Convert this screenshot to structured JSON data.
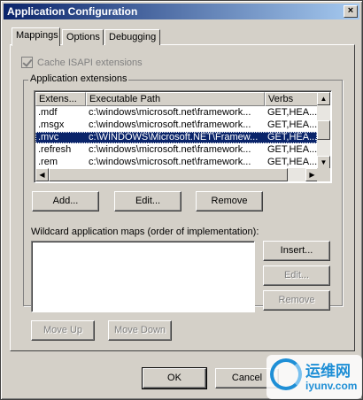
{
  "window": {
    "title": "Application Configuration",
    "close_label": "×"
  },
  "tabs": [
    {
      "label": "Mappings",
      "active": true
    },
    {
      "label": "Options",
      "active": false
    },
    {
      "label": "Debugging",
      "active": false
    }
  ],
  "mappings": {
    "cache_isapi": {
      "label": "Cache ISAPI extensions",
      "checked": true,
      "enabled": false
    },
    "group_title": "Application extensions",
    "list": {
      "columns": [
        "Extens...",
        "Executable Path",
        "Verbs"
      ],
      "rows": [
        {
          "ext": ".mdf",
          "path": "c:\\windows\\microsoft.net\\framework...",
          "verbs": "GET,HEA...",
          "selected": false
        },
        {
          "ext": ".msgx",
          "path": "c:\\windows\\microsoft.net\\framework...",
          "verbs": "GET,HEA...",
          "selected": false
        },
        {
          "ext": ".mvc",
          "path": "c:\\WINDOWS\\Microsoft.NET\\Framew...",
          "verbs": "GET,HEA...",
          "selected": true
        },
        {
          "ext": ".refresh",
          "path": "c:\\windows\\microsoft.net\\framework...",
          "verbs": "GET,HEA...",
          "selected": false
        },
        {
          "ext": ".rem",
          "path": "c:\\windows\\microsoft.net\\framework...",
          "verbs": "GET,HEA...",
          "selected": false
        }
      ]
    },
    "buttons": {
      "add": "Add...",
      "edit": "Edit...",
      "remove": "Remove"
    },
    "wildcard_label": "Wildcard application maps (order of implementation):",
    "wildcard_buttons": {
      "insert": "Insert...",
      "edit": "Edit...",
      "remove": "Remove"
    },
    "move_up": "Move Up",
    "move_down": "Move Down"
  },
  "footer": {
    "ok": "OK",
    "cancel": "Cancel"
  },
  "watermark": {
    "name": "运维网",
    "url": "iyunv.com"
  }
}
